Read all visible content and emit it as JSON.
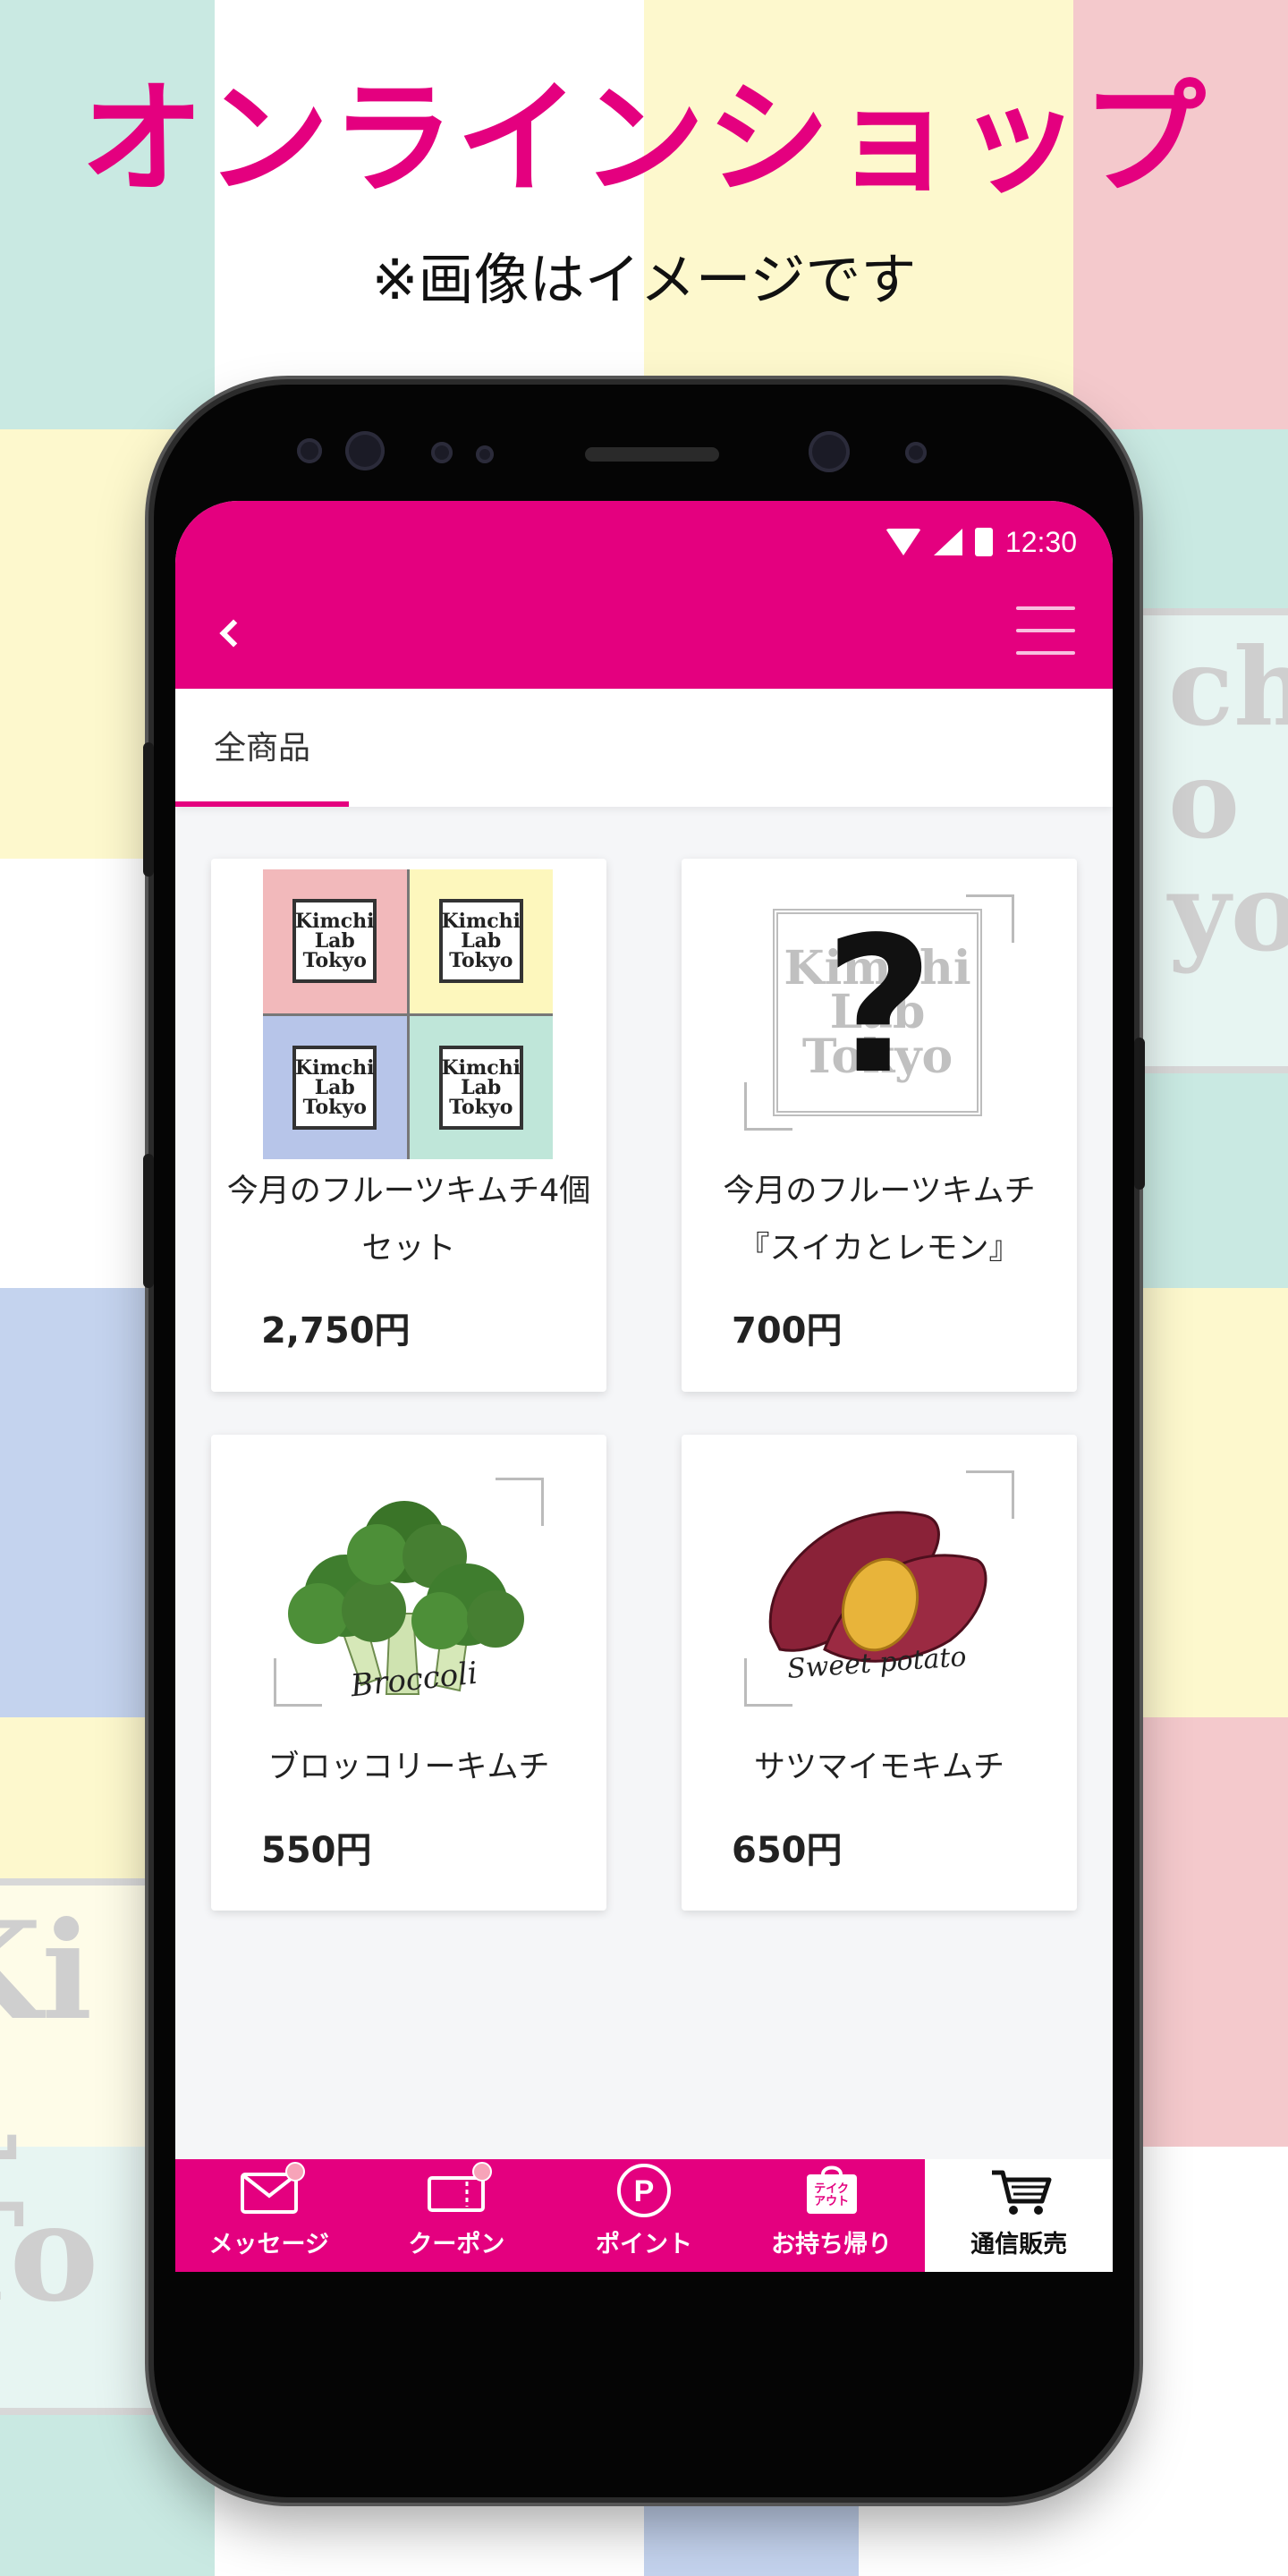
{
  "promo": {
    "headline": "オンラインショップ",
    "subline": "※画像はイメージです"
  },
  "background": {
    "logo_text_right": "chi\no\nyo",
    "logo_text_left": "Ki\nL\nTo"
  },
  "status_bar": {
    "time": "12:30"
  },
  "header": {
    "back_icon": "chevron-left-icon",
    "menu_icon": "hamburger-menu-icon"
  },
  "tabs": [
    {
      "label": "全商品",
      "active": true
    }
  ],
  "products": [
    {
      "name": "今月のフルーツキムチ4個セット",
      "price": "2,750円",
      "image_logo": "Kimchi Lab Tokyo"
    },
    {
      "name": "今月のフルーツキムチ『スイカとレモン』",
      "price": "700円",
      "image_text": "Kimchi Lab Tokyo",
      "image_symbol": "?"
    },
    {
      "name": "ブロッコリーキムチ",
      "price": "550円",
      "image_caption": "Broccoli"
    },
    {
      "name": "サツマイモキムチ",
      "price": "650円",
      "image_caption": "Sweet potato"
    }
  ],
  "bottom_nav": [
    {
      "label": "メッセージ",
      "icon": "envelope-icon",
      "badge": true
    },
    {
      "label": "クーポン",
      "icon": "coupon-icon",
      "badge": true
    },
    {
      "label": "ポイント",
      "icon": "point-p-icon"
    },
    {
      "label": "お持ち帰り",
      "icon": "takeout-bag-icon",
      "icon_text": "テイク\nアウト"
    },
    {
      "label": "通信販売",
      "icon": "cart-icon",
      "active": true
    }
  ],
  "colors": {
    "brand": "#e4007f",
    "badge": "#f7a3b8"
  }
}
